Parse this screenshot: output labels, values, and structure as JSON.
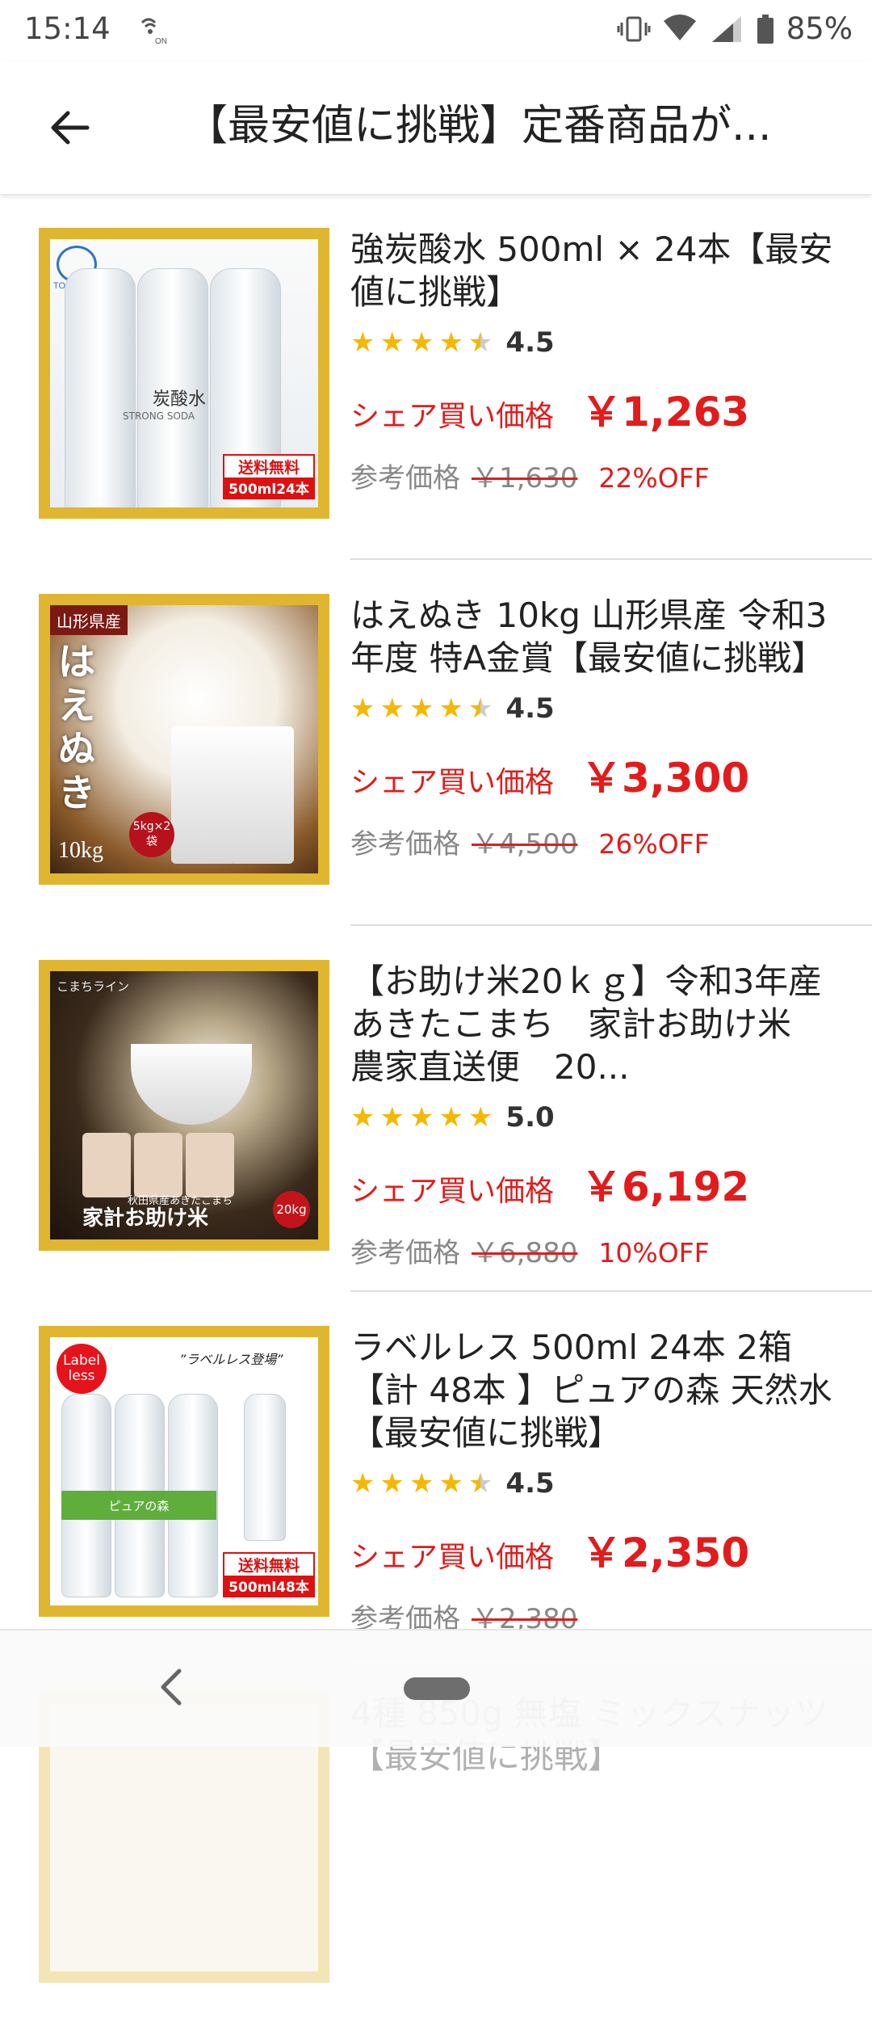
{
  "status_bar": {
    "time": "15:14",
    "nfc_label": "ON",
    "battery_percent": "85%",
    "icons": [
      "vibrate-icon",
      "wifi-icon",
      "signal-icon",
      "battery-icon"
    ]
  },
  "header": {
    "title": "【最安値に挑戦】定番商品が..."
  },
  "products": [
    {
      "name": "強炭酸水 500ml × 24本【最安値に挑戦】",
      "rating": "4.5",
      "rating_value": 4.5,
      "price_label": "シェア買い価格",
      "price": "￥1,263",
      "ref_label": "参考価格",
      "ref_price": "￥1,630",
      "discount": "22%OFF",
      "image": {
        "brand": "TOMOMASU",
        "bottle_text": "炭酸水",
        "bottle_sub": "STRONG SODA",
        "badge_top": "送料無料",
        "badge_bottom": "500ml24本"
      }
    },
    {
      "name": "はえぬき 10kg 山形県産 令和3年度 特A金賞【最安値に挑戦】",
      "rating": "4.5",
      "rating_value": 4.5,
      "price_label": "シェア買い価格",
      "price": "￥3,300",
      "ref_label": "参考価格",
      "ref_price": "￥4,500",
      "discount": "26%OFF",
      "image": {
        "region": "山形県産",
        "brand": "はえぬき",
        "weight": "10kg",
        "badge": "5kg×2袋"
      }
    },
    {
      "name": "【お助け米20ｋｇ】令和3年産　あきたこまち　家計お助け米　農家直送便　20...",
      "rating": "5.0",
      "rating_value": 5.0,
      "price_label": "シェア買い価格",
      "price": "￥6,192",
      "ref_label": "参考価格",
      "ref_price": "￥6,880",
      "discount": "10%OFF",
      "image": {
        "tag": "こまちライン",
        "sub": "秋田県産あきたこまち",
        "brand": "家計お助け米",
        "weight": "20kg"
      }
    },
    {
      "name": "ラベルレス 500ml 24本 2箱【計 48本 】ピュアの森 天然水【最安値に挑戦】",
      "rating": "4.5",
      "rating_value": 4.5,
      "price_label": "シェア買い価格",
      "price": "￥2,350",
      "ref_label": "参考価格",
      "ref_price": "￥2,380",
      "discount": "",
      "image": {
        "badge_label": "Label less",
        "caption": "”ラベルレス登場”",
        "bottle_text": "ピュアの森",
        "badge_top": "送料無料",
        "badge_bottom": "500ml48本"
      }
    },
    {
      "name": "4種 850g 無塩 ミックスナッツ【最安値に挑戦】"
    }
  ]
}
